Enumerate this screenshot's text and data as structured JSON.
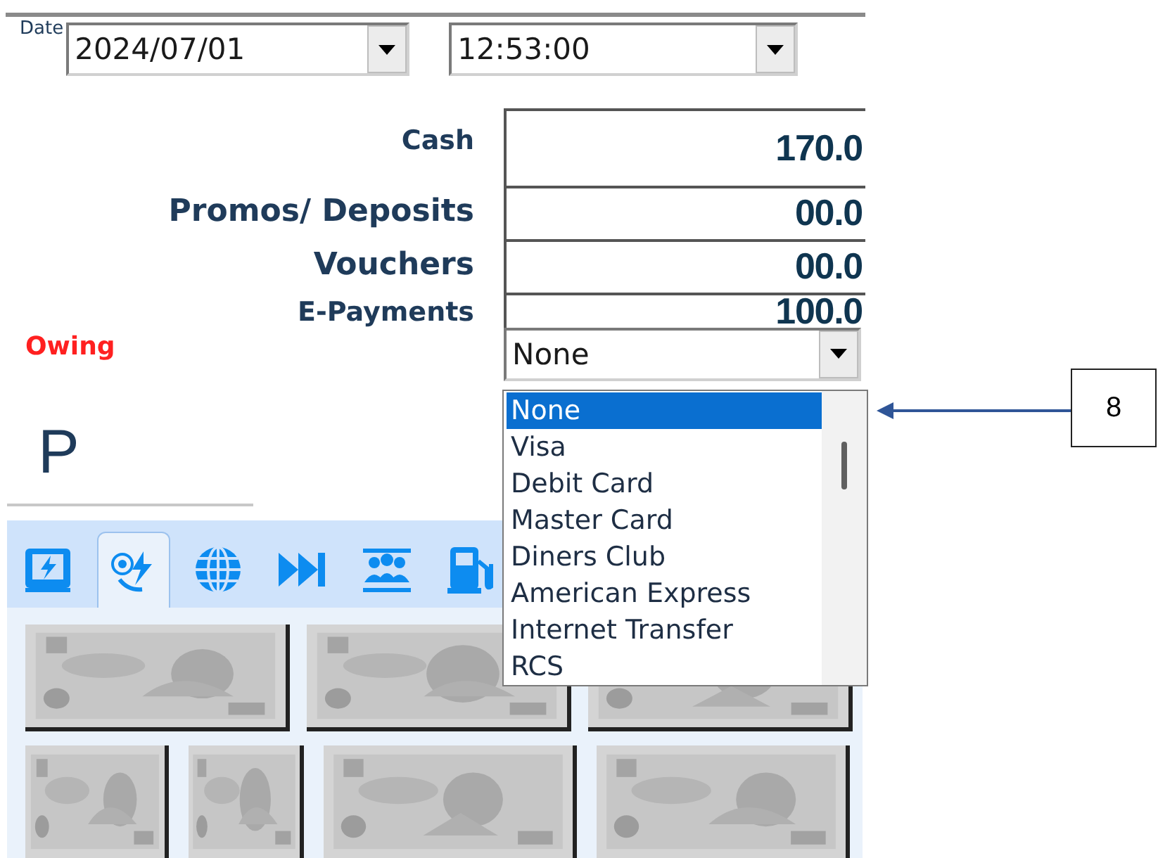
{
  "date_field": {
    "label": "Date",
    "value": "2024/07/01"
  },
  "time_field": {
    "value": "12:53:00"
  },
  "amounts": [
    {
      "label": "Cash",
      "value": "170.0"
    },
    {
      "label": "Promos/ Deposits",
      "value": "00.0"
    },
    {
      "label": "Vouchers",
      "value": "00.0"
    },
    {
      "label": "E-Payments",
      "value": "100.0"
    }
  ],
  "owing": {
    "label": "Owing",
    "value": "None",
    "expanded": true,
    "options": [
      {
        "label": "None",
        "selected": true
      },
      {
        "label": "Visa",
        "selected": false
      },
      {
        "label": "Debit Card",
        "selected": false
      },
      {
        "label": "Master Card",
        "selected": false
      },
      {
        "label": "Diners Club",
        "selected": false
      },
      {
        "label": "American Express",
        "selected": false
      },
      {
        "label": "Internet Transfer",
        "selected": false
      },
      {
        "label": "RCS",
        "selected": false
      }
    ]
  },
  "heading": "P",
  "tabs": [
    {
      "kind": "bolt",
      "selected": false
    },
    {
      "kind": "coins",
      "selected": true
    },
    {
      "kind": "globe",
      "selected": false
    },
    {
      "kind": "skip",
      "selected": false
    },
    {
      "kind": "people",
      "selected": false
    },
    {
      "kind": "fuel",
      "selected": false
    }
  ],
  "callout": {
    "label": "8"
  }
}
